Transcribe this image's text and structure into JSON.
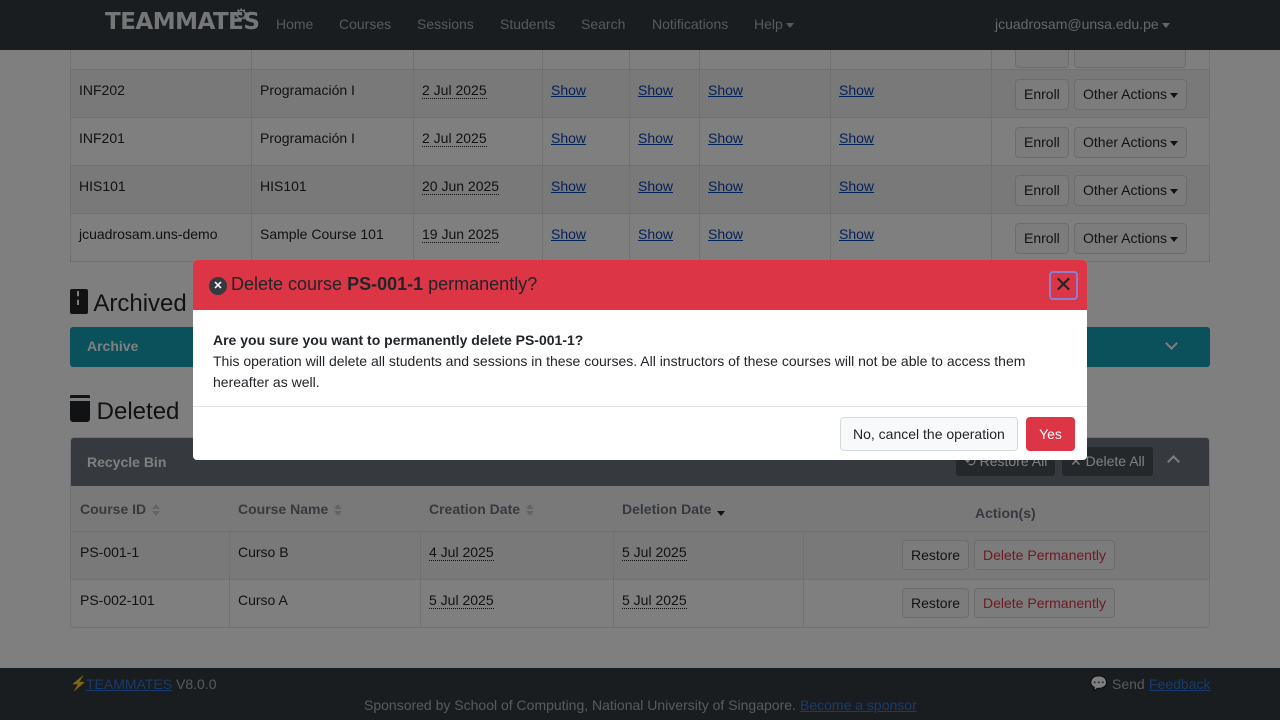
{
  "navbar": {
    "brand": "TEAMMATES",
    "links": [
      "Home",
      "Courses",
      "Sessions",
      "Students",
      "Search",
      "Notifications"
    ],
    "help": "Help",
    "user": "jcuadrosam@unsa.edu.pe"
  },
  "courses": {
    "rows": [
      {
        "id": "INF202",
        "name": "Programación I",
        "date": "2 Jul 2025",
        "show1": "Show",
        "show2": "Show",
        "show3": "Show",
        "show4": "Show"
      },
      {
        "id": "INF201",
        "name": "Programación I",
        "date": "2 Jul 2025",
        "show1": "Show",
        "show2": "Show",
        "show3": "Show",
        "show4": "Show"
      },
      {
        "id": "HIS101",
        "name": "HIS101",
        "date": "20 Jun 2025",
        "show1": "Show",
        "show2": "Show",
        "show3": "Show",
        "show4": "Show"
      },
      {
        "id": "jcuadrosam.uns-demo",
        "name": "Sample Course 101",
        "date": "19 Jun 2025",
        "show1": "Show",
        "show2": "Show",
        "show3": "Show",
        "show4": "Show"
      }
    ],
    "enroll_label": "Enroll",
    "other_actions_label": "Other Actions"
  },
  "archived": {
    "heading": "Archived",
    "panel_label": "Archive"
  },
  "deleted": {
    "heading": "Deleted",
    "panel_label": "Recycle Bin",
    "restore_all": "Restore All",
    "delete_all": "Delete All",
    "columns": [
      "Course ID",
      "Course Name",
      "Creation Date",
      "Deletion Date",
      "Action(s)"
    ],
    "rows": [
      {
        "id": "PS-001-1",
        "name": "Curso B",
        "created": "4 Jul 2025",
        "deleted": "5 Jul 2025"
      },
      {
        "id": "PS-002-101",
        "name": "Curso A",
        "created": "5 Jul 2025",
        "deleted": "5 Jul 2025"
      }
    ],
    "restore_label": "Restore",
    "delete_perm_label": "Delete Permanently"
  },
  "modal": {
    "title_prefix": "Delete course",
    "title_course": "PS-001-1",
    "title_suffix": "permanently?",
    "question": "Are you sure you want to permanently delete PS-001-1?",
    "message": "This operation will delete all students and sessions in these courses. All instructors of these courses will not be able to access them hereafter as well.",
    "cancel_label": "No, cancel the operation",
    "confirm_label": "Yes",
    "close_symbol": "✕"
  },
  "footer": {
    "brand_link": "TEAMMATES",
    "version": "V8.0.0",
    "send": "Send",
    "feedback_link": "Feedback",
    "sponsor_text": "Sponsored by School of Computing, National University of Singapore.",
    "sponsor_link": "Become a sponsor"
  },
  "colors": {
    "navbar": "#343a40",
    "danger": "#dc3545",
    "info": "#17a2b8",
    "secondary": "#6c757d"
  }
}
